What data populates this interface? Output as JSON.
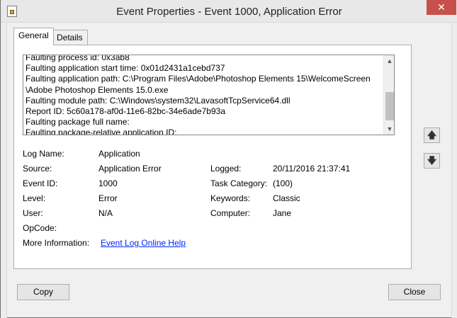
{
  "window": {
    "title": "Event Properties - Event 1000, Application Error",
    "close_glyph": "✕"
  },
  "tabs": [
    {
      "label": "General",
      "selected": true
    },
    {
      "label": "Details",
      "selected": false
    }
  ],
  "description": {
    "lines": [
      "Faulting process id: 0x3ab8",
      "Faulting application start time: 0x01d2431a1cebd737",
      "Faulting application path: C:\\Program Files\\Adobe\\Photoshop Elements 15\\WelcomeScreen",
      "\\Adobe Photoshop Elements 15.0.exe",
      "Faulting module path: C:\\Windows\\system32\\LavasoftTcpService64.dll",
      "Report ID: 5c60a178-af0d-11e6-82bc-34e6ade7b93a",
      "Faulting package full name:",
      "Faulting package-relative application ID:"
    ]
  },
  "fields": {
    "log_name": {
      "label": "Log Name:",
      "value": "Application"
    },
    "source": {
      "label": "Source:",
      "value": "Application Error"
    },
    "logged": {
      "label": "Logged:",
      "value": "20/11/2016 21:37:41"
    },
    "event_id": {
      "label": "Event ID:",
      "value": "1000"
    },
    "task_category": {
      "label": "Task Category:",
      "value": "(100)"
    },
    "level": {
      "label": "Level:",
      "value": "Error"
    },
    "keywords": {
      "label": "Keywords:",
      "value": "Classic"
    },
    "user": {
      "label": "User:",
      "value": "N/A"
    },
    "computer": {
      "label": "Computer:",
      "value": "Jane"
    },
    "opcode": {
      "label": "OpCode:",
      "value": ""
    },
    "more_info": {
      "label": "More Information:",
      "link": "Event Log Online Help"
    }
  },
  "nav": {
    "up_glyph": "🡅",
    "down_glyph": "🡇"
  },
  "buttons": {
    "copy": "Copy",
    "close": "Close"
  },
  "colors": {
    "link": "#0026ff",
    "close_button": "#c7504b"
  }
}
